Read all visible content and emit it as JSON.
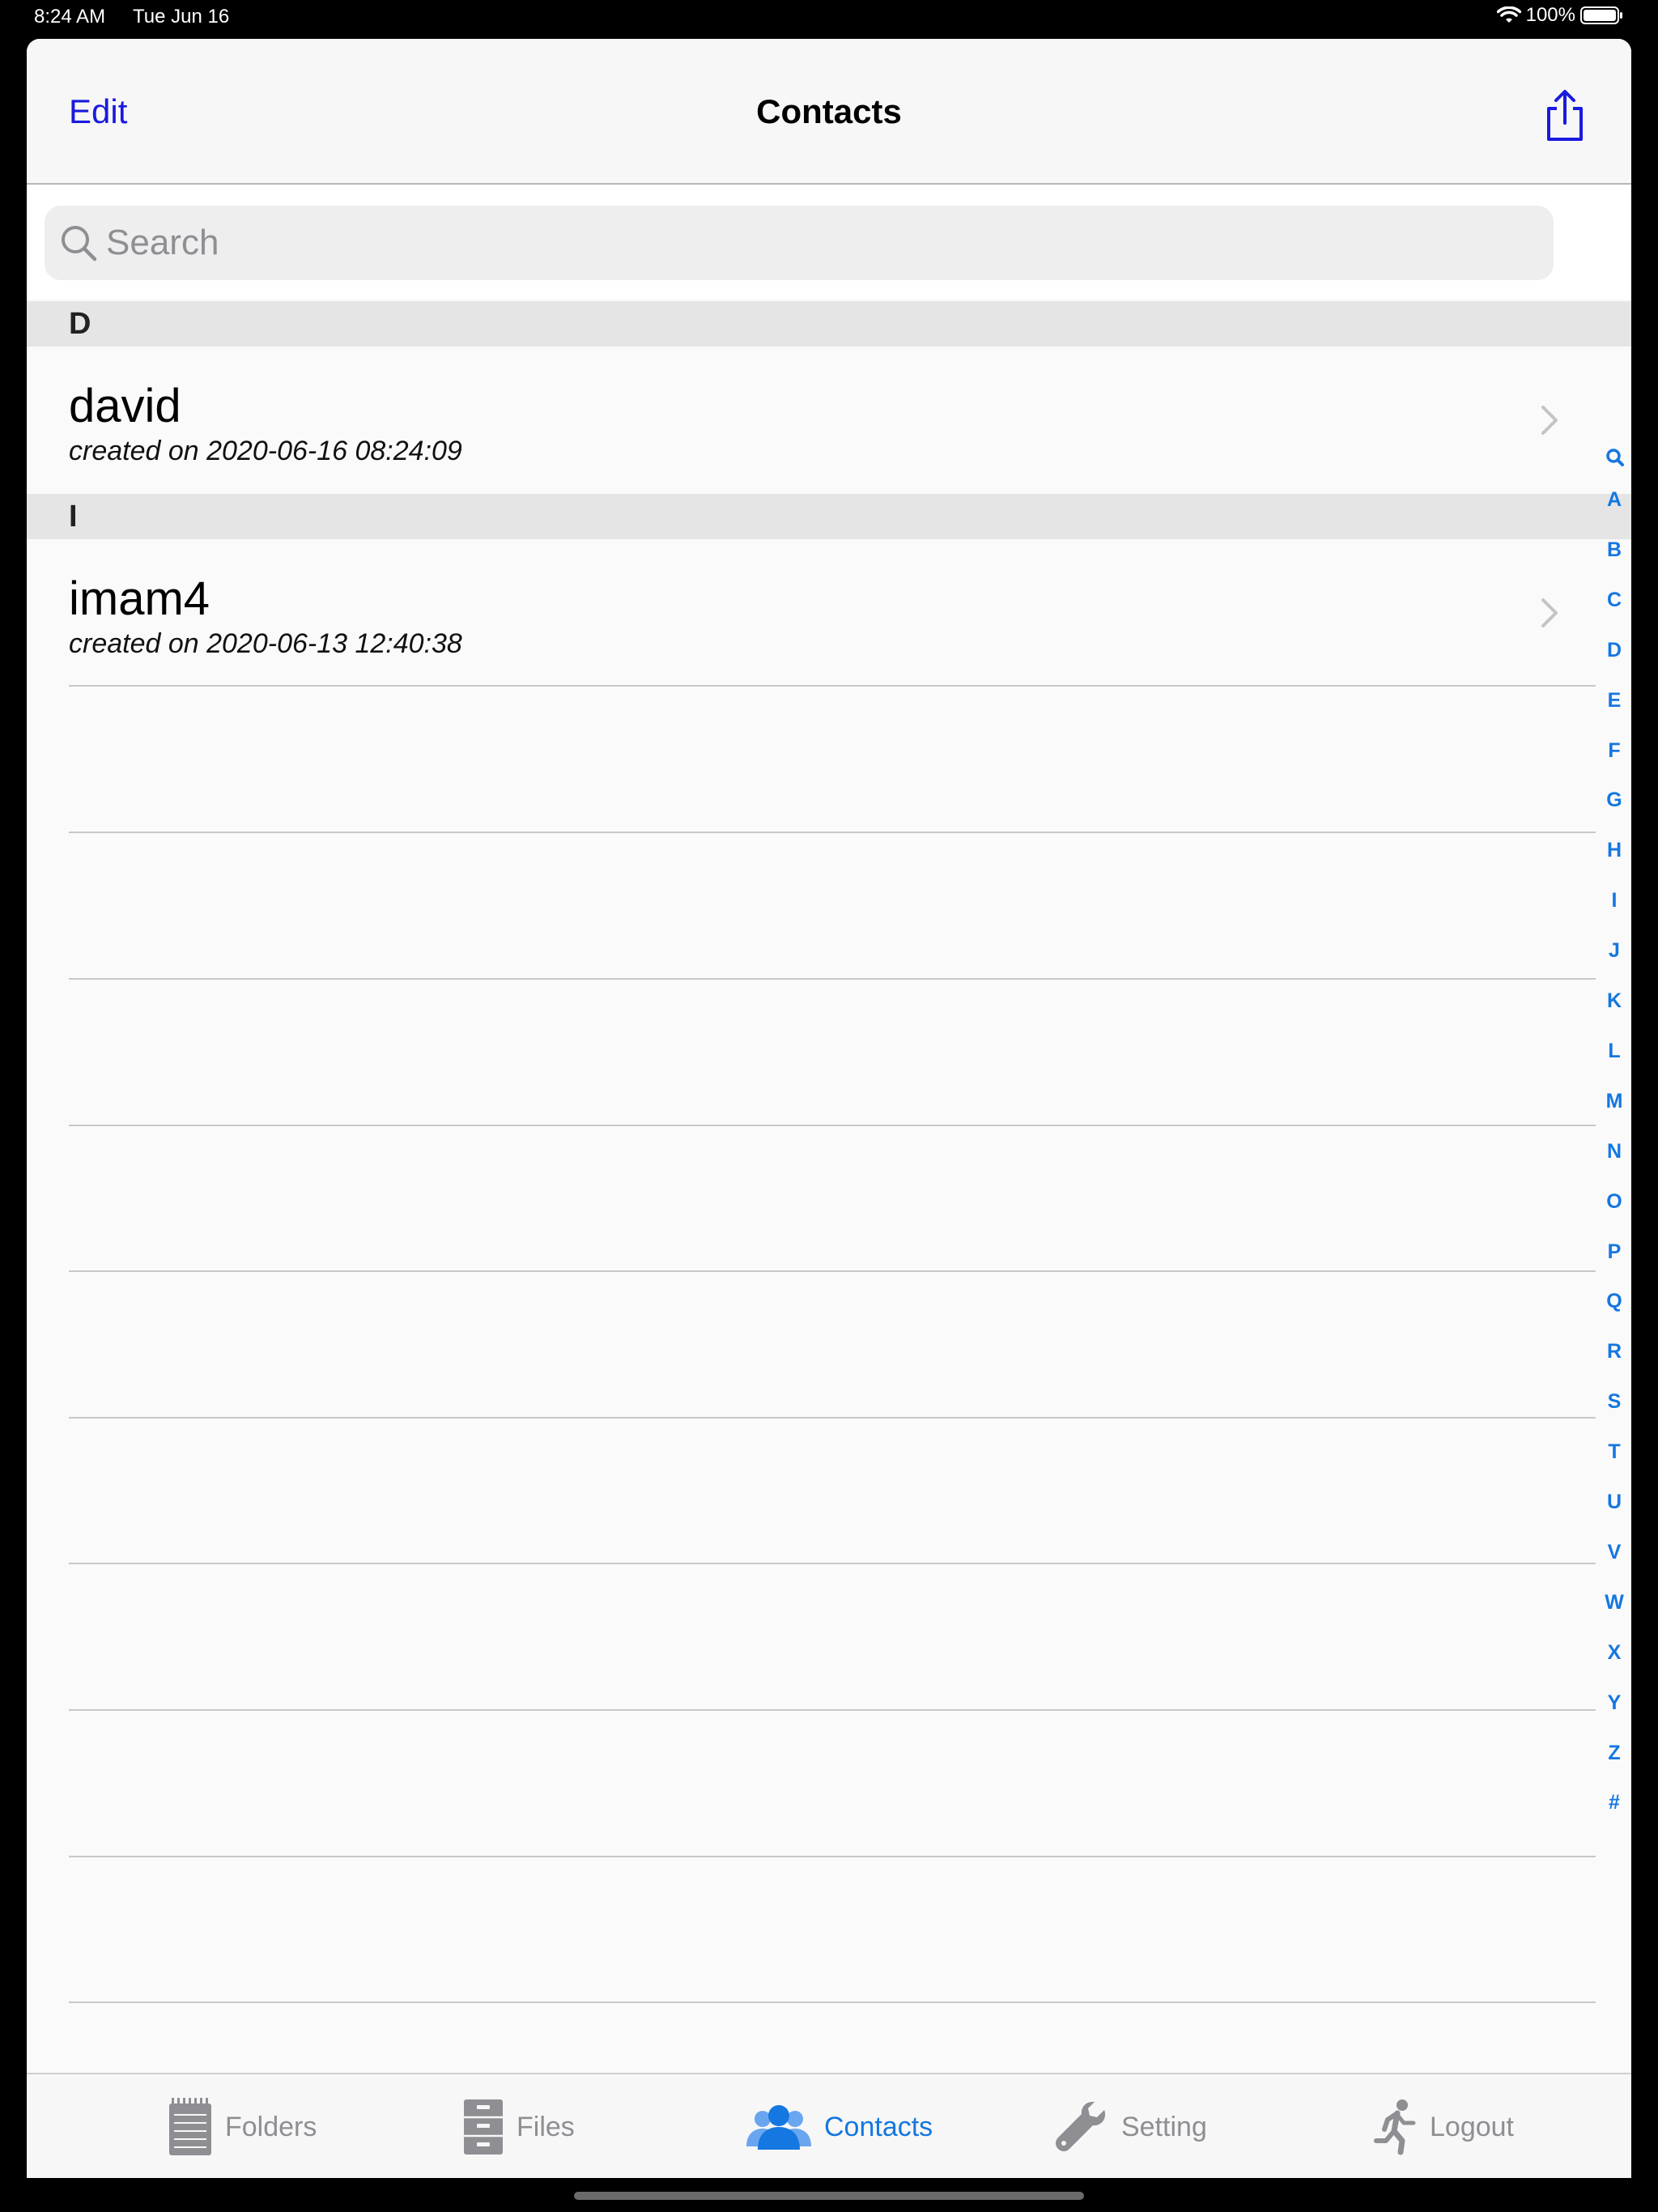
{
  "status_bar": {
    "time": "8:24 AM",
    "date": "Tue Jun 16",
    "battery": "100%"
  },
  "nav": {
    "edit_label": "Edit",
    "title": "Contacts"
  },
  "search": {
    "placeholder": "Search",
    "value": ""
  },
  "sections": [
    {
      "header": "D",
      "rows": [
        {
          "name": "david",
          "subtitle": "created on 2020-06-16 08:24:09"
        }
      ]
    },
    {
      "header": "I",
      "rows": [
        {
          "name": "imam4",
          "subtitle": "created on 2020-06-13 12:40:38"
        }
      ]
    }
  ],
  "index_letters": [
    "A",
    "B",
    "C",
    "D",
    "E",
    "F",
    "G",
    "H",
    "I",
    "J",
    "K",
    "L",
    "M",
    "N",
    "O",
    "P",
    "Q",
    "R",
    "S",
    "T",
    "U",
    "V",
    "W",
    "X",
    "Y",
    "Z",
    "#"
  ],
  "tabs": [
    {
      "label": "Folders",
      "icon": "notepad-icon",
      "active": false
    },
    {
      "label": "Files",
      "icon": "cabinet-icon",
      "active": false
    },
    {
      "label": "Contacts",
      "icon": "people-icon",
      "active": true
    },
    {
      "label": "Setting",
      "icon": "wrench-icon",
      "active": false
    },
    {
      "label": "Logout",
      "icon": "running-man-icon",
      "active": false
    }
  ],
  "colors": {
    "accent": "#1577e0",
    "nav_link": "#1a1ade",
    "inactive_tab": "#8e8e93"
  }
}
